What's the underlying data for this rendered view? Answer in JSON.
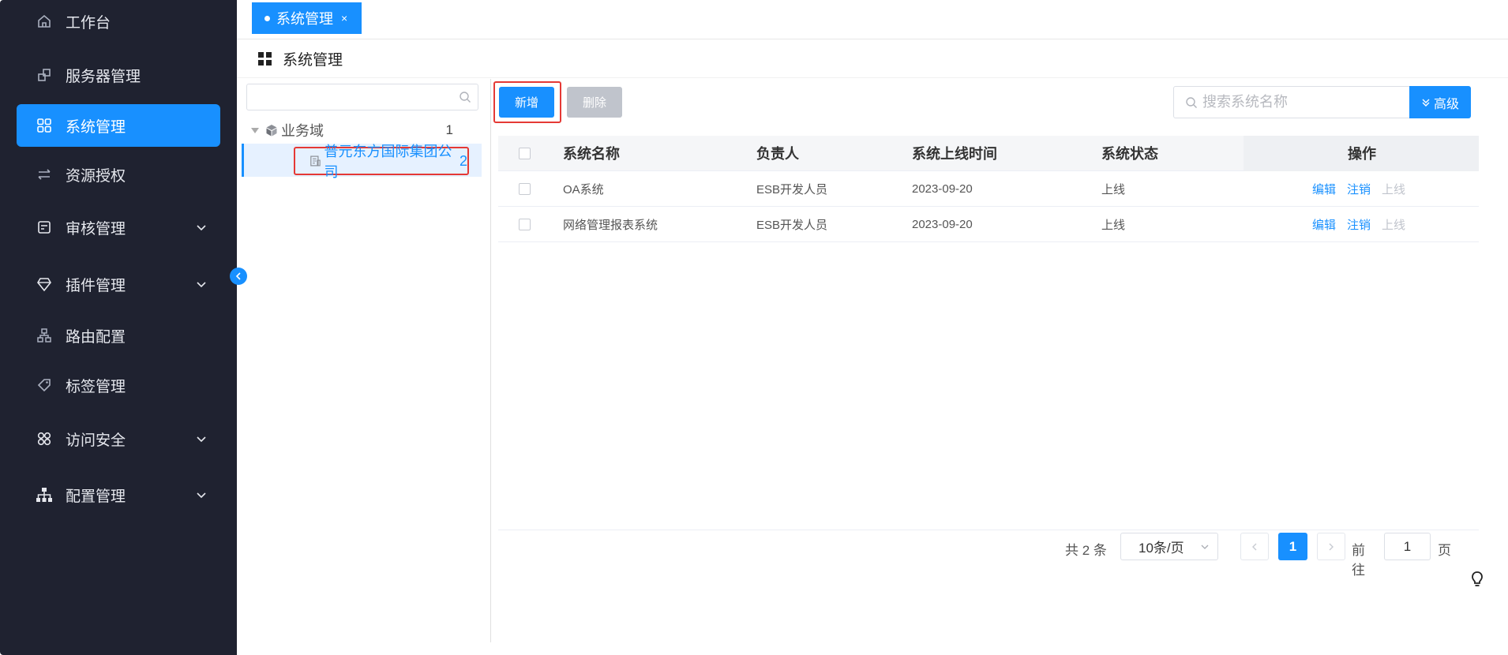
{
  "sidebar": {
    "items": [
      {
        "label": "工作台",
        "icon": "home-icon"
      },
      {
        "label": "服务器管理",
        "icon": "server-icon"
      },
      {
        "label": "系统管理",
        "icon": "grid-icon",
        "active": true
      },
      {
        "label": "资源授权",
        "icon": "swap-icon"
      },
      {
        "label": "审核管理",
        "icon": "audit-icon",
        "expandable": true
      },
      {
        "label": "插件管理",
        "icon": "diamond-icon",
        "expandable": true
      },
      {
        "label": "路由配置",
        "icon": "route-icon"
      },
      {
        "label": "标签管理",
        "icon": "tag-icon"
      },
      {
        "label": "访问安全",
        "icon": "security-icon",
        "expandable": true
      },
      {
        "label": "配置管理",
        "icon": "hierarchy-icon",
        "expandable": true
      }
    ]
  },
  "tabs": [
    {
      "label": "系统管理",
      "close": "×"
    }
  ],
  "page": {
    "title": "系统管理"
  },
  "tree": {
    "search_placeholder": "",
    "root": {
      "label": "业务域",
      "count": "1"
    },
    "child": {
      "label": "普元东方国际集团公司",
      "count": "2"
    }
  },
  "toolbar": {
    "add_label": "新增",
    "delete_label": "删除",
    "search_placeholder": "搜索系统名称",
    "advanced_label": "高级"
  },
  "table": {
    "columns": [
      "系统名称",
      "负责人",
      "系统上线时间",
      "系统状态",
      "操作"
    ],
    "rows": [
      {
        "name": "OA系统",
        "owner": "ESB开发人员",
        "date": "2023-09-20",
        "status": "上线",
        "actions": [
          "编辑",
          "注销",
          "上线"
        ]
      },
      {
        "name": "网络管理报表系统",
        "owner": "ESB开发人员",
        "date": "2023-09-20",
        "status": "上线",
        "actions": [
          "编辑",
          "注销",
          "上线"
        ]
      }
    ]
  },
  "pagination": {
    "total": "共 2 条",
    "page_size": "10条/页",
    "current_page": "1",
    "goto_label": "前往",
    "goto_value": "1",
    "page_unit": "页"
  },
  "colors": {
    "primary": "#1890ff",
    "sidebar_bg": "#1f2230",
    "highlight_border": "#e53935",
    "disabled": "#c0c4cc"
  }
}
